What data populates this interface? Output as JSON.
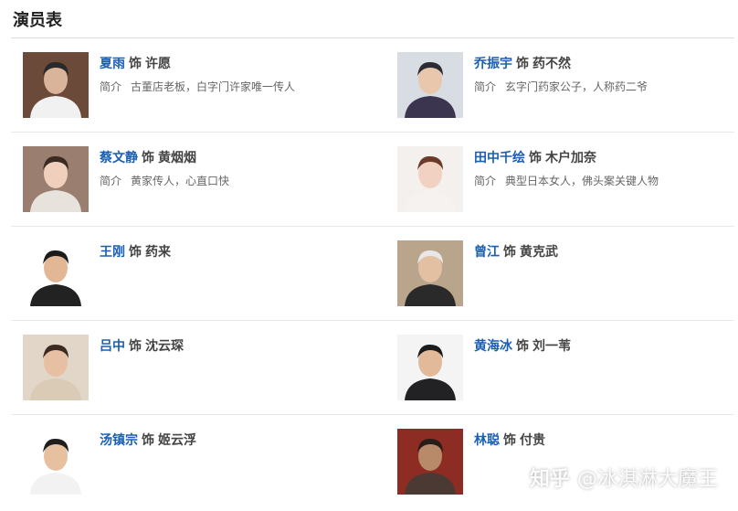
{
  "section": {
    "title": "演员表"
  },
  "labels": {
    "as": "饰",
    "intro": "简介"
  },
  "cast": [
    {
      "actor": "夏雨",
      "role": "许愿",
      "intro": "古董店老板，白字门许家唯一传人",
      "photo": "actor-photo-xia-yu"
    },
    {
      "actor": "乔振宇",
      "role": "药不然",
      "intro": "玄字门药家公子，人称药二爷",
      "photo": "actor-photo-qiao-zhenyu"
    },
    {
      "actor": "蔡文静",
      "role": "黄烟烟",
      "intro": "黄家传人，心直口快",
      "photo": "actor-photo-cai-wenjing"
    },
    {
      "actor": "田中千绘",
      "role": "木户加奈",
      "intro": "典型日本女人，佛头案关键人物",
      "photo": "actor-photo-tianzhong-qianhui"
    },
    {
      "actor": "王刚",
      "role": "药来",
      "intro": "",
      "photo": "actor-photo-wang-gang"
    },
    {
      "actor": "曾江",
      "role": "黄克武",
      "intro": "",
      "photo": "actor-photo-zeng-jiang"
    },
    {
      "actor": "吕中",
      "role": "沈云琛",
      "intro": "",
      "photo": "actor-photo-lv-zhong"
    },
    {
      "actor": "黄海冰",
      "role": "刘一苇",
      "intro": "",
      "photo": "actor-photo-huang-haibing"
    },
    {
      "actor": "汤镇宗",
      "role": "姬云浮",
      "intro": "",
      "photo": "actor-photo-tang-zhenzong"
    },
    {
      "actor": "林聪",
      "role": "付贵",
      "intro": "",
      "photo": "actor-photo-lin-cong"
    }
  ],
  "watermark": {
    "brand": "知乎",
    "handle": "@冰淇淋大魔王"
  }
}
